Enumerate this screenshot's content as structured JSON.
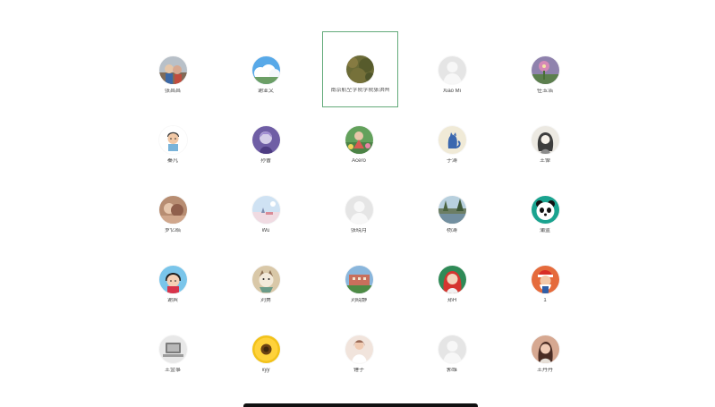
{
  "contacts": [
    {
      "name": "张昌昌",
      "avatar_icon": "kids-photo-icon"
    },
    {
      "name": "谢亚文",
      "avatar_icon": "sky-clouds-icon"
    },
    {
      "name": "南京航空学院学院张洪州",
      "avatar_icon": "grass-field-icon",
      "selected": true
    },
    {
      "name": "Xiao Mi",
      "avatar_icon": "default-user-icon"
    },
    {
      "name": "任玉浩",
      "avatar_icon": "flower-purple-icon"
    },
    {
      "name": "秦凡",
      "avatar_icon": "cartoon-boy-icon"
    },
    {
      "name": "孙曹",
      "avatar_icon": "purple-anime-icon"
    },
    {
      "name": "Acero",
      "avatar_icon": "girl-garden-icon"
    },
    {
      "name": "于涛",
      "avatar_icon": "blue-cat-icon"
    },
    {
      "name": "王倬",
      "avatar_icon": "ink-portrait-icon"
    },
    {
      "name": "罗亿皓",
      "avatar_icon": "warm-photo-icon"
    },
    {
      "name": "Wu",
      "avatar_icon": "pastel-sky-icon"
    },
    {
      "name": "张晓月",
      "avatar_icon": "default-user-icon"
    },
    {
      "name": "杨涛",
      "avatar_icon": "lake-trees-icon"
    },
    {
      "name": "蒲蓝",
      "avatar_icon": "panda-icon"
    },
    {
      "name": "谢宾",
      "avatar_icon": "maruko-icon"
    },
    {
      "name": "刘勇",
      "avatar_icon": "cat-bowl-icon"
    },
    {
      "name": "刘晓静",
      "avatar_icon": "campus-icon"
    },
    {
      "name": "郑H",
      "avatar_icon": "red-hair-girl-icon"
    },
    {
      "name": "1",
      "avatar_icon": "santa-icon"
    },
    {
      "name": "王金事",
      "avatar_icon": "laptop-icon"
    },
    {
      "name": "xyy",
      "avatar_icon": "sunflower-icon"
    },
    {
      "name": "锤子",
      "avatar_icon": "bride-icon"
    },
    {
      "name": "郭维",
      "avatar_icon": "default-user-icon"
    },
    {
      "name": "王丹丹",
      "avatar_icon": "girl-portrait-icon"
    }
  ],
  "colors": {
    "selection_border": "#63aa7a",
    "label_text": "#444444",
    "default_avatar": "#e5e5e5"
  }
}
